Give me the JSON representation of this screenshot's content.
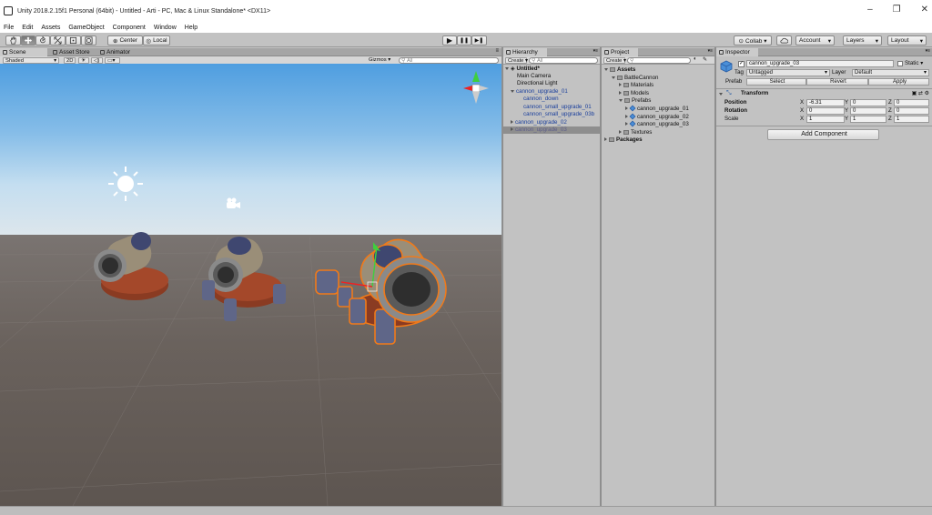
{
  "window": {
    "title": "Unity 2018.2.15f1 Personal (64bit) - Untitled - Arti - PC, Mac & Linux Standalone* <DX11>",
    "controls": [
      "–",
      "❐",
      "✕"
    ]
  },
  "menu": [
    "File",
    "Edit",
    "Assets",
    "GameObject",
    "Component",
    "Window",
    "Help"
  ],
  "toolbar": {
    "transform_tools": [
      "hand-icon",
      "move-icon",
      "rotate-icon",
      "scale-icon",
      "rect-icon",
      "transform-icon"
    ],
    "pivot_label": "Center",
    "space_label": "Local",
    "play_icons": [
      "▶",
      "❚❚",
      "▶❚"
    ],
    "collab_label": "Collab ▾",
    "cloud_icon": "cloud-icon",
    "account_label": "Account",
    "layers_label": "Layers",
    "layout_label": "Layout"
  },
  "scene": {
    "tabs": [
      "Scene",
      "Asset Store",
      "Animator"
    ],
    "shading": "Shaded",
    "mode_2d": "2D",
    "gizmos_label": "Gizmos ▾",
    "search_placeholder": "All"
  },
  "hierarchy": {
    "tab": "Hierarchy",
    "create_label": "Create ▾",
    "search_placeholder": "All",
    "scene_name": "Untitled*",
    "items": [
      {
        "label": "Main Camera",
        "indent": 1,
        "style": "normal"
      },
      {
        "label": "Directional Light",
        "indent": 1,
        "style": "normal"
      },
      {
        "label": "cannon_upgrade_01",
        "indent": 1,
        "style": "blue",
        "expanded": true
      },
      {
        "label": "cannon_down",
        "indent": 2,
        "style": "blue"
      },
      {
        "label": "cannon_small_upgrade_01",
        "indent": 2,
        "style": "blue"
      },
      {
        "label": "cannon_small_upgrade_03b",
        "indent": 2,
        "style": "blue"
      },
      {
        "label": "cannon_upgrade_02",
        "indent": 1,
        "style": "blue",
        "expanded": false
      },
      {
        "label": "cannon_upgrade_03",
        "indent": 1,
        "style": "selected",
        "expanded": false
      }
    ]
  },
  "project": {
    "tab": "Project",
    "create_label": "Create ▾",
    "items": [
      {
        "label": "Assets",
        "indent": 0,
        "bold": true,
        "type": "folder",
        "expanded": true
      },
      {
        "label": "BattleCannon",
        "indent": 1,
        "type": "folder",
        "expanded": true
      },
      {
        "label": "Materials",
        "indent": 2,
        "type": "folder"
      },
      {
        "label": "Models",
        "indent": 2,
        "type": "folder"
      },
      {
        "label": "Prefabs",
        "indent": 2,
        "type": "folder",
        "expanded": true
      },
      {
        "label": "cannon_upgrade_01",
        "indent": 3,
        "type": "prefab"
      },
      {
        "label": "cannon_upgrade_02",
        "indent": 3,
        "type": "prefab"
      },
      {
        "label": "cannon_upgrade_03",
        "indent": 3,
        "type": "prefab"
      },
      {
        "label": "Textures",
        "indent": 2,
        "type": "folder"
      },
      {
        "label": "Packages",
        "indent": 0,
        "bold": true,
        "type": "folder"
      }
    ]
  },
  "inspector": {
    "tab": "Inspector",
    "object_name": "cannon_upgrade_03",
    "static_label": "Static ▾",
    "tag_label": "Tag",
    "tag_value": "Untagged",
    "layer_label": "Layer",
    "layer_value": "Default",
    "prefab_label": "Prefab",
    "prefab_buttons": [
      "Select",
      "Revert",
      "Apply"
    ],
    "transform_title": "Transform",
    "rows": [
      {
        "label": "Position",
        "bold": true,
        "x": "-6.31",
        "y": "0",
        "z": "0"
      },
      {
        "label": "Rotation",
        "bold": true,
        "x": "0",
        "y": "0",
        "z": "0"
      },
      {
        "label": "Scale",
        "bold": false,
        "x": "1",
        "y": "1",
        "z": "1"
      }
    ],
    "add_component": "Add Component"
  },
  "colors": {
    "selection_outline": "#f07a1a",
    "prefab_blue": "#1a3f9c"
  }
}
